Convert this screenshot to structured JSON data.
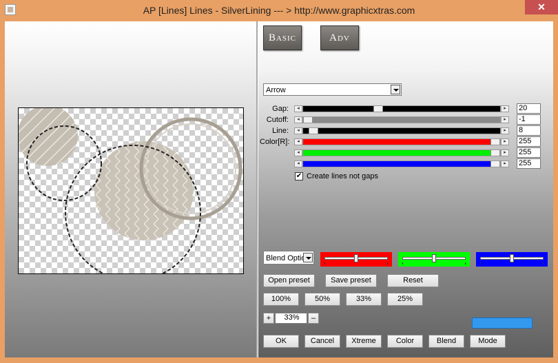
{
  "window": {
    "title": "AP [Lines]  Lines - SilverLining     --- > http://www.graphicxtras.com",
    "close_glyph": "✕"
  },
  "tabs": {
    "basic": "Basic",
    "adv": "Adv"
  },
  "mode_select": {
    "value": "Arrow"
  },
  "controls": {
    "gap": {
      "label": "Gap:",
      "value": "20",
      "color": "#000000"
    },
    "cutoff": {
      "label": "Cutoff:",
      "value": "-1",
      "color": "#8a8a8a"
    },
    "line": {
      "label": "Line:",
      "value": "8",
      "color": "#000000"
    },
    "red": {
      "label": "Color[R]:",
      "value": "255",
      "color": "#ff0000"
    },
    "green": {
      "label": "",
      "value": "255",
      "color": "#00ee00"
    },
    "blue": {
      "label": "",
      "value": "255",
      "color": "#0000ff"
    }
  },
  "checkbox": {
    "label": "Create lines not gaps",
    "checked": true,
    "glyph": "✔"
  },
  "blend_select": {
    "value": "Blend Optio"
  },
  "rgb_sliders": {
    "red": {
      "color": "#ff0000",
      "level": 0.5
    },
    "green": {
      "color": "#00ff00",
      "level": 0.5
    },
    "blue": {
      "color": "#0000ff",
      "level": 0.5
    }
  },
  "buttons": {
    "open_preset": "Open preset",
    "save_preset": "Save preset",
    "reset": "Reset",
    "zoom_100": "100%",
    "zoom_50": "50%",
    "zoom_33": "33%",
    "zoom_25": "25%",
    "zoom_plus": "+",
    "zoom_minus": "–",
    "zoom_value": "33%",
    "ok": "OK",
    "cancel": "Cancel",
    "xtreme": "Xtreme",
    "color": "Color",
    "blend": "Blend",
    "mode": "Mode"
  },
  "color_swatch": "#3399ee",
  "arrows": {
    "left": "◂",
    "right": "▸"
  }
}
